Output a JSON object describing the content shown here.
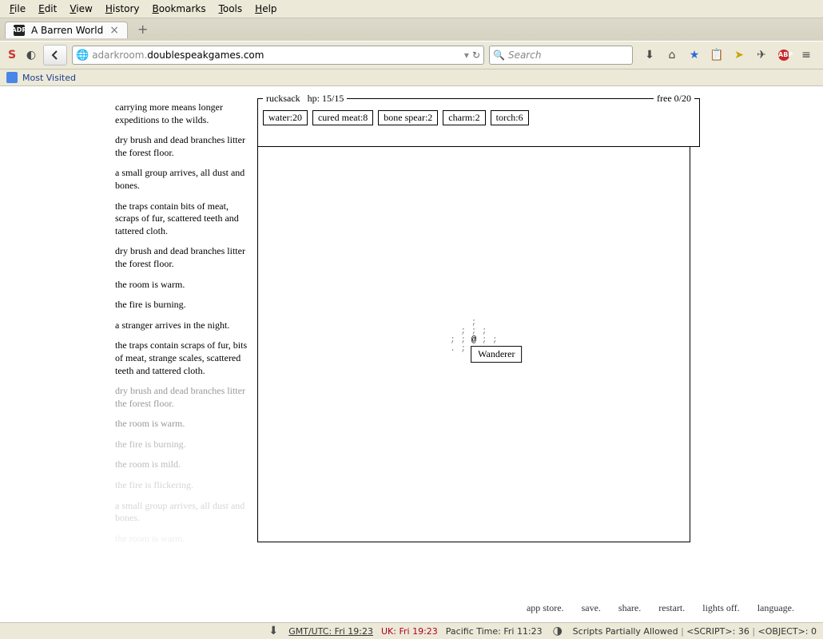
{
  "window": {
    "menus": [
      "File",
      "Edit",
      "View",
      "History",
      "Bookmarks",
      "Tools",
      "Help"
    ],
    "tab_title": "A Barren World",
    "url_pre": "adarkroom.",
    "url_host": "doublespeakgames.com",
    "search_placeholder": "Search",
    "bookmark_bar": "Most Visited"
  },
  "notifications": [
    {
      "t": "carrying more means longer expeditions to the wilds.",
      "f": 0
    },
    {
      "t": "dry brush and dead branches litter the forest floor.",
      "f": 0
    },
    {
      "t": "a small group arrives, all dust and bones.",
      "f": 0
    },
    {
      "t": "the traps contain bits of meat, scraps of fur, scattered teeth and tattered cloth.",
      "f": 0
    },
    {
      "t": "dry brush and dead branches litter the forest floor.",
      "f": 0
    },
    {
      "t": "the room is warm.",
      "f": 0
    },
    {
      "t": "the fire is burning.",
      "f": 0
    },
    {
      "t": "a stranger arrives in the night.",
      "f": 0
    },
    {
      "t": "the traps contain scraps of fur, bits of meat, strange scales, scattered teeth and tattered cloth.",
      "f": 0
    },
    {
      "t": "dry brush and dead branches litter the forest floor.",
      "f": 1
    },
    {
      "t": "the room is warm.",
      "f": 1
    },
    {
      "t": "the fire is burning.",
      "f": 2
    },
    {
      "t": "the room is mild.",
      "f": 2
    },
    {
      "t": "the fire is flickering.",
      "f": 3
    },
    {
      "t": "a small group arrives, all dust and bones.",
      "f": 3
    },
    {
      "t": "the room is warm.",
      "f": 4
    }
  ],
  "rucksack": {
    "label": "rucksack",
    "hp_label": "hp:",
    "hp_cur": 15,
    "hp_max": 15,
    "free_label": "free",
    "free_cur": 0,
    "free_max": 20,
    "items": [
      {
        "name": "water",
        "qty": 20
      },
      {
        "name": "cured meat",
        "qty": 8
      },
      {
        "name": "bone spear",
        "qty": 2
      },
      {
        "name": "charm",
        "qty": 2
      },
      {
        "name": "torch",
        "qty": 6
      }
    ]
  },
  "world": {
    "map_rows": [
      "    ;    ",
      "  ; ; ;  ",
      "; ; @ ; ;",
      ". ; ; ; ;",
      "         "
    ],
    "tooltip": "Wanderer"
  },
  "footer_links": [
    "app store.",
    "save.",
    "share.",
    "restart.",
    "lights off.",
    "language."
  ],
  "statusbar": {
    "gmt": "GMT/UTC: Fri 19:23",
    "uk": "UK: Fri 19:23",
    "pacific": "Pacific Time: Fri 11:23",
    "script_status": "Scripts Partially Allowed",
    "script_count_label": "<SCRIPT>:",
    "script_count": 36,
    "object_count_label": "<OBJECT>:",
    "object_count": 0
  }
}
